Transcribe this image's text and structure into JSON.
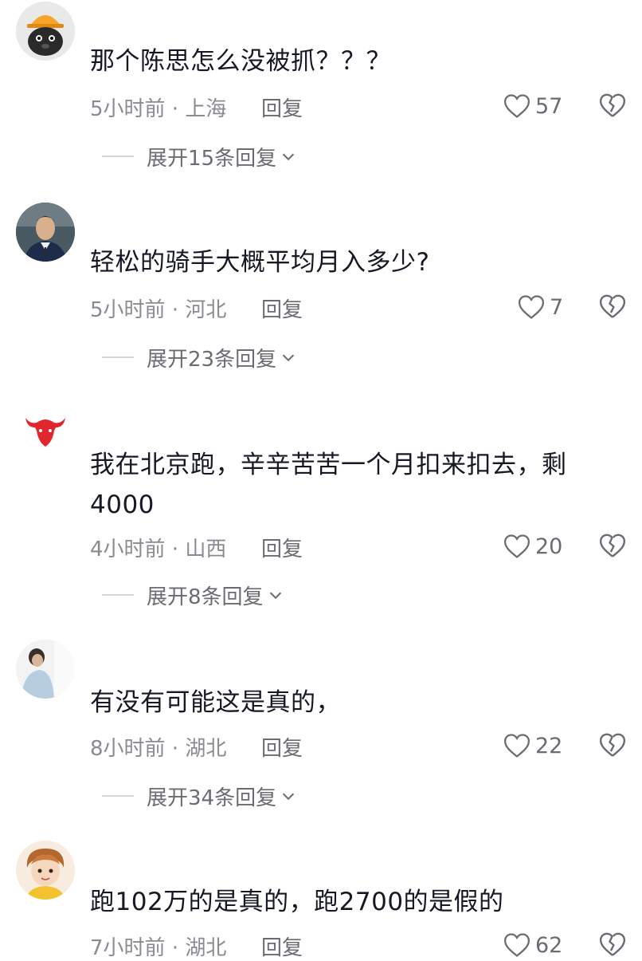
{
  "comments": [
    {
      "text": "那个陈思怎么没被抓？？？",
      "time": "5小时前",
      "location": "上海",
      "reply_label": "回复",
      "likes": "57",
      "expand_label": "展开15条回复",
      "avatar_icon": "black-cat-hardhat-avatar"
    },
    {
      "text": "轻松的骑手大概平均月入多少?",
      "time": "5小时前",
      "location": "河北",
      "reply_label": "回复",
      "likes": "7",
      "expand_label": "展开23条回复",
      "avatar_icon": "police-officer-avatar"
    },
    {
      "text": "我在北京跑，辛辛苦苦一个月扣来扣去，剩4000",
      "time": "4小时前",
      "location": "山西",
      "reply_label": "回复",
      "likes": "20",
      "expand_label": "展开8条回复",
      "avatar_icon": "red-bull-logo-avatar"
    },
    {
      "text": "有没有可能这是真的，",
      "time": "8小时前",
      "location": "湖北",
      "reply_label": "回复",
      "likes": "22",
      "expand_label": "展开34条回复",
      "avatar_icon": "person-photo-avatar"
    },
    {
      "text": "跑102万的是真的，跑2700的是假的",
      "time": "7小时前",
      "location": "湖北",
      "reply_label": "回复",
      "likes": "62",
      "avatar_icon": "cartoon-boy-avatar"
    }
  ],
  "separator": " · ",
  "colors": {
    "text": "#161823",
    "meta": "#8a8b91",
    "icon": "#6b6c72",
    "bull": "#e1262c"
  }
}
